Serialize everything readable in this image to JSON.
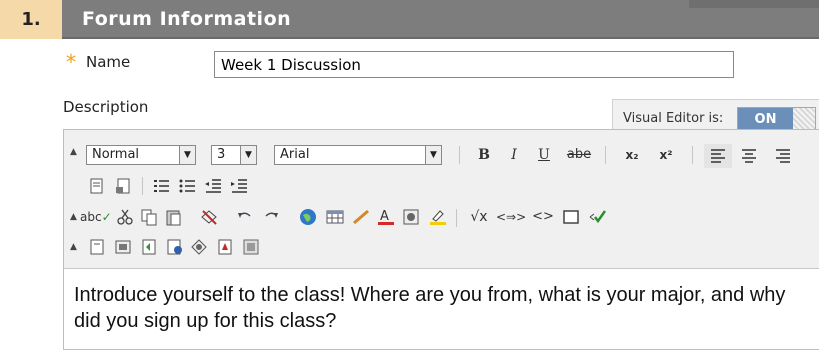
{
  "section": {
    "number": "1.",
    "title": "Forum Information"
  },
  "name_field": {
    "label": "Name",
    "value": "Week 1 Discussion",
    "required_mark": "*"
  },
  "description": {
    "label": "Description"
  },
  "visual_editor": {
    "label": "Visual Editor is:",
    "state": "ON"
  },
  "toolbar": {
    "format_select": "Normal",
    "size_select": "3",
    "font_select": "Arial",
    "bold": "B",
    "italic": "I",
    "underline": "U",
    "strike": "abe",
    "subscript": "x₂",
    "superscript": "x²",
    "spellcheck": "abc",
    "html_view": "<>",
    "link": "<⇒>"
  },
  "content": {
    "text": "Introduce yourself to the class!  Where are you from, what is your major, and why did you sign up for this class?"
  },
  "colors": {
    "header_number_bg": "#f6d9a8",
    "header_bar_bg": "#7d7d7d",
    "required_star": "#f39c12",
    "toggle_on_bg": "#6b8fb8"
  }
}
